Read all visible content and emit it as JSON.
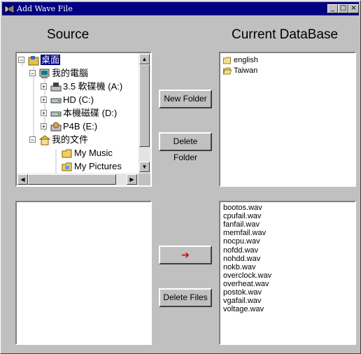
{
  "window": {
    "title": "Add Wave File",
    "minimize_glyph": "_",
    "maximize_glyph": "□",
    "close_glyph": "×",
    "titlebar_color": "#000080",
    "face_color": "#c0c0c0"
  },
  "source": {
    "heading": "Source",
    "tree": [
      {
        "label": "桌面",
        "icon": "desktop-icon",
        "selected": true
      },
      {
        "label": "我的電腦",
        "icon": "my-computer-icon"
      },
      {
        "label": "3.5 軟碟機 (A:)",
        "icon": "floppy-drive-icon"
      },
      {
        "label": "HD (C:)",
        "icon": "hard-drive-icon"
      },
      {
        "label": "本機磁碟 (D:)",
        "icon": "hard-drive-icon"
      },
      {
        "label": "P4B (E:)",
        "icon": "cd-drive-icon"
      },
      {
        "label": "我的文件",
        "icon": "my-documents-icon"
      },
      {
        "label": "My Music",
        "icon": "folder-icon"
      },
      {
        "label": "My Pictures",
        "icon": "pictures-folder-icon"
      }
    ]
  },
  "database": {
    "heading": "Current DataBase",
    "folders": [
      {
        "label": "english",
        "icon": "folder-closed-icon"
      },
      {
        "label": "Taiwan",
        "icon": "folder-open-icon"
      }
    ],
    "files": [
      "bootos.wav",
      "cpufail.wav",
      "fanfail.wav",
      "memfail.wav",
      "nocpu.wav",
      "nofdd.wav",
      "nohdd.wav",
      "nokb.wav",
      "overclock.wav",
      "overheat.wav",
      "postok.wav",
      "vgafail.wav",
      "voltage.wav"
    ]
  },
  "buttons": {
    "new_folder": "New Folder",
    "delete_folder": "Delete Folder",
    "transfer_arrow": "➔",
    "delete_files": "Delete Files"
  },
  "colors": {
    "selection": "#000080",
    "arrow": "#d00000",
    "folder": "#f0d060"
  }
}
